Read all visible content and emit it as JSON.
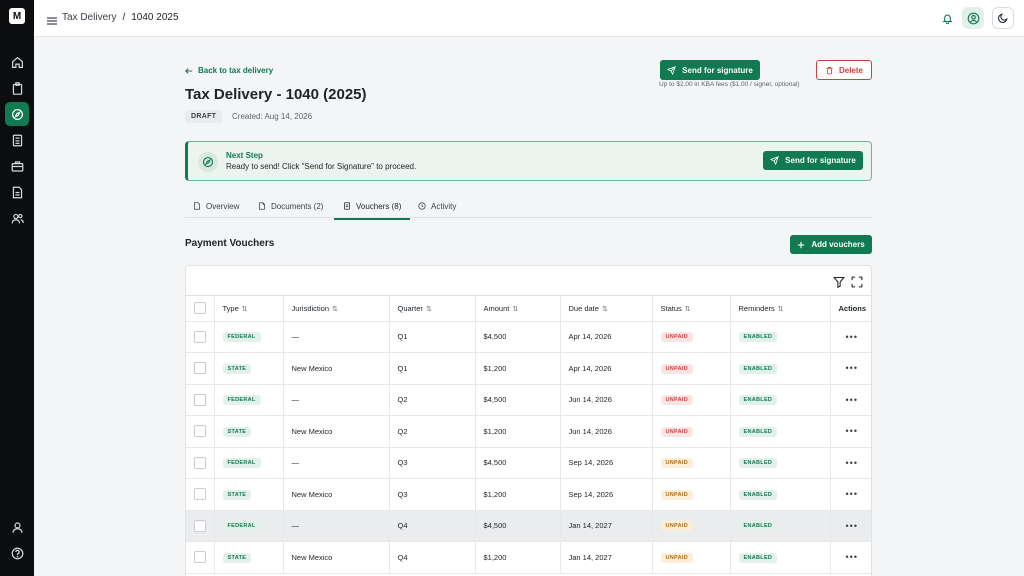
{
  "app": {
    "logo_text": "M",
    "accent": "#117a52"
  },
  "topbar": {
    "breadcrumb_root": "Tax Delivery",
    "breadcrumb_sep": "/",
    "breadcrumb_current": "1040 2025"
  },
  "sidebar": {
    "items": [
      {
        "icon": "home-icon"
      },
      {
        "icon": "clipboard-icon"
      },
      {
        "icon": "compass-icon",
        "active": true
      },
      {
        "icon": "calculator-icon"
      },
      {
        "icon": "briefcase-icon"
      },
      {
        "icon": "document-icon"
      },
      {
        "icon": "users-icon"
      }
    ],
    "bottom_items": [
      {
        "icon": "user-icon"
      },
      {
        "icon": "help-icon"
      }
    ]
  },
  "header": {
    "back_label": "Back to tax delivery",
    "title": "Tax Delivery - 1040 (2025)",
    "status_badge": "DRAFT",
    "created": "Created: Aug 14, 2026",
    "send_label": "Send for signature",
    "kba_note": "Up to $2.00 in KBA fees ($1.00 / signer, optional)",
    "delete_label": "Delete"
  },
  "next_step": {
    "title": "Next Step",
    "description": "Ready to send! Click \"Send for Signature\" to proceed.",
    "button_label": "Send for signature"
  },
  "tabs": [
    {
      "label": "Overview",
      "icon": "document-icon"
    },
    {
      "label": "Documents (2)",
      "icon": "file-icon"
    },
    {
      "label": "Vouchers (8)",
      "icon": "receipt-icon",
      "active": true
    },
    {
      "label": "Activity",
      "icon": "clock-icon"
    }
  ],
  "vouchers": {
    "title": "Payment Vouchers",
    "add_label": "Add vouchers",
    "columns": [
      "Type",
      "Jurisdiction",
      "Quarter",
      "Amount",
      "Due date",
      "Status",
      "Reminders",
      "Actions"
    ],
    "sort_glyph": "⇅",
    "actions_glyph": "•••",
    "rows": [
      {
        "type": "FEDERAL",
        "jurisdiction": "—",
        "quarter": "Q1",
        "amount": "$4,500",
        "due": "Apr 14, 2026",
        "status": "UNPAID",
        "status_tone": "red",
        "reminders": "ENABLED"
      },
      {
        "type": "STATE",
        "jurisdiction": "New Mexico",
        "quarter": "Q1",
        "amount": "$1,200",
        "due": "Apr 14, 2026",
        "status": "UNPAID",
        "status_tone": "red",
        "reminders": "ENABLED"
      },
      {
        "type": "FEDERAL",
        "jurisdiction": "—",
        "quarter": "Q2",
        "amount": "$4,500",
        "due": "Jun 14, 2026",
        "status": "UNPAID",
        "status_tone": "red",
        "reminders": "ENABLED"
      },
      {
        "type": "STATE",
        "jurisdiction": "New Mexico",
        "quarter": "Q2",
        "amount": "$1,200",
        "due": "Jun 14, 2026",
        "status": "UNPAID",
        "status_tone": "red",
        "reminders": "ENABLED"
      },
      {
        "type": "FEDERAL",
        "jurisdiction": "—",
        "quarter": "Q3",
        "amount": "$4,500",
        "due": "Sep 14, 2026",
        "status": "UNPAID",
        "status_tone": "amber",
        "reminders": "ENABLED"
      },
      {
        "type": "STATE",
        "jurisdiction": "New Mexico",
        "quarter": "Q3",
        "amount": "$1,200",
        "due": "Sep 14, 2026",
        "status": "UNPAID",
        "status_tone": "amber",
        "reminders": "ENABLED"
      },
      {
        "type": "FEDERAL",
        "jurisdiction": "—",
        "quarter": "Q4",
        "amount": "$4,500",
        "due": "Jan 14, 2027",
        "status": "UNPAID",
        "status_tone": "amber",
        "reminders": "ENABLED",
        "highlight": true
      },
      {
        "type": "STATE",
        "jurisdiction": "New Mexico",
        "quarter": "Q4",
        "amount": "$1,200",
        "due": "Jan 14, 2027",
        "status": "UNPAID",
        "status_tone": "amber",
        "reminders": "ENABLED"
      }
    ]
  }
}
